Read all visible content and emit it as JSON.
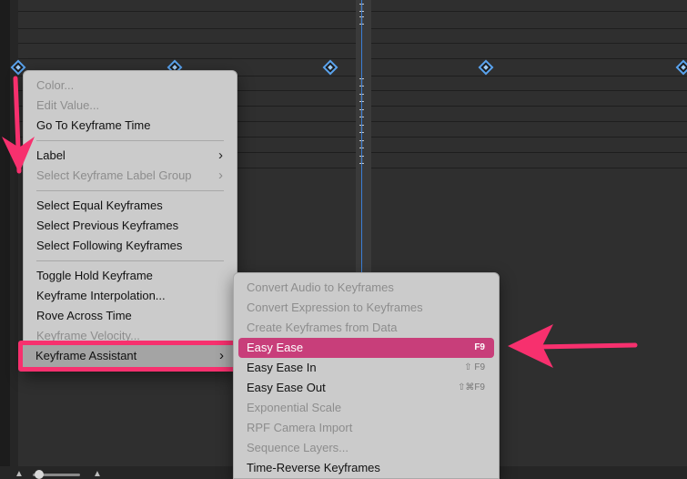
{
  "context_menu": {
    "items": [
      {
        "label": "Color...",
        "enabled": false
      },
      {
        "label": "Edit Value...",
        "enabled": false
      },
      {
        "label": "Go To Keyframe Time",
        "enabled": true
      },
      {
        "label": "Label",
        "enabled": true,
        "submenu": true
      },
      {
        "label": "Select Keyframe Label Group",
        "enabled": false,
        "submenu": true
      },
      {
        "label": "Select Equal Keyframes",
        "enabled": true
      },
      {
        "label": "Select Previous Keyframes",
        "enabled": true
      },
      {
        "label": "Select Following Keyframes",
        "enabled": true
      },
      {
        "label": "Toggle Hold Keyframe",
        "enabled": true
      },
      {
        "label": "Keyframe Interpolation...",
        "enabled": true
      },
      {
        "label": "Rove Across Time",
        "enabled": true
      },
      {
        "label": "Keyframe Velocity...",
        "enabled": false
      },
      {
        "label": "Keyframe Assistant",
        "enabled": true,
        "submenu": true,
        "selected": true
      }
    ]
  },
  "submenu": {
    "items": [
      {
        "label": "Convert Audio to Keyframes",
        "enabled": false,
        "shortcut": ""
      },
      {
        "label": "Convert Expression to Keyframes",
        "enabled": false,
        "shortcut": ""
      },
      {
        "label": "Create Keyframes from Data",
        "enabled": false,
        "shortcut": ""
      },
      {
        "label": "Easy Ease",
        "enabled": true,
        "shortcut": "F9",
        "highlighted": true
      },
      {
        "label": "Easy Ease In",
        "enabled": true,
        "shortcut": "⇧ F9"
      },
      {
        "label": "Easy Ease Out",
        "enabled": true,
        "shortcut": "⇧⌘F9"
      },
      {
        "label": "Exponential Scale",
        "enabled": false,
        "shortcut": ""
      },
      {
        "label": "RPF Camera Import",
        "enabled": false,
        "shortcut": ""
      },
      {
        "label": "Sequence Layers...",
        "enabled": false,
        "shortcut": ""
      },
      {
        "label": "Time-Reverse Keyframes",
        "enabled": true,
        "shortcut": ""
      }
    ]
  },
  "icons": {
    "chevron": "chevron-right-icon",
    "ibeam": "keyframe-ibeam-icon",
    "keyframe": "keyframe-diamond-icon"
  },
  "colors": {
    "highlight": "#c83e7a",
    "annotation": "#f7306e",
    "playhead": "#3b7fd6",
    "keyframe": "#5aa3ee"
  }
}
